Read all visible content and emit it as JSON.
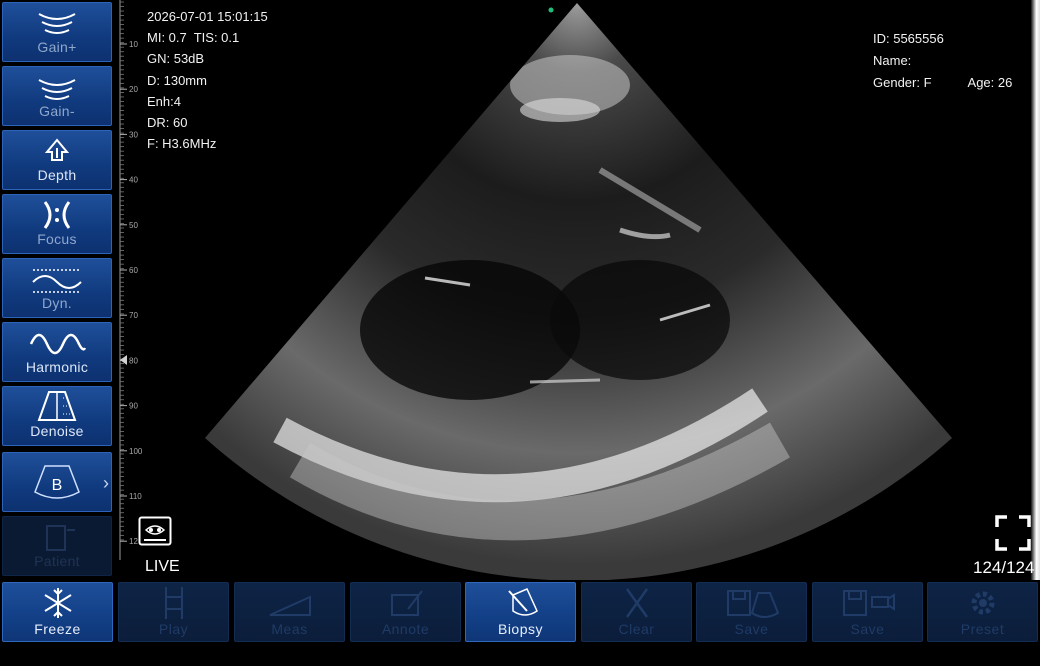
{
  "sidebar": {
    "items": [
      {
        "label": "Gain+",
        "icon": "gain-up-icon",
        "state": "enabled-faded"
      },
      {
        "label": "Gain-",
        "icon": "gain-down-icon",
        "state": "enabled-faded"
      },
      {
        "label": "Depth",
        "icon": "depth-icon",
        "state": "enabled"
      },
      {
        "label": "Focus",
        "icon": "focus-icon",
        "state": "enabled-faded"
      },
      {
        "label": "Dyn.",
        "icon": "dynamic-range-icon",
        "state": "enabled-faded"
      },
      {
        "label": "Harmonic",
        "icon": "harmonic-icon",
        "state": "enabled"
      },
      {
        "label": "Denoise",
        "icon": "denoise-icon",
        "state": "enabled"
      },
      {
        "label": "B",
        "icon": "b-mode-icon",
        "state": "enabled",
        "expand": "›"
      },
      {
        "label": "Patient",
        "icon": "patient-icon",
        "state": "disabled"
      }
    ]
  },
  "ruler": {
    "ticks": [
      "10",
      "20",
      "30",
      "40",
      "50",
      "60",
      "70",
      "80",
      "90",
      "100",
      "110",
      "12"
    ],
    "focus_marker": "80"
  },
  "params": {
    "datetime": "2026-07-01 15:01:15",
    "mi_tis": "MI: 0.7  TIS: 0.1",
    "gain": "GN: 53dB",
    "depth": "D: 130mm",
    "enhance": "Enh:4",
    "dynamic_range": "DR: 60",
    "frequency": "F: H3.6MHz"
  },
  "patient": {
    "id": "ID: 5565556",
    "name": "Name:",
    "gender": "Gender: F",
    "age": "Age: 26"
  },
  "status": {
    "live": "LIVE",
    "frame_count": "124/124"
  },
  "toolbar": {
    "items": [
      {
        "label": "Freeze",
        "icon": "snowflake-icon",
        "active": true
      },
      {
        "label": "Play",
        "icon": "play-film-icon",
        "active": false
      },
      {
        "label": "Meas",
        "icon": "measure-icon",
        "active": false
      },
      {
        "label": "Annote",
        "icon": "annotate-icon",
        "active": false
      },
      {
        "label": "Biopsy",
        "icon": "biopsy-icon",
        "active": true
      },
      {
        "label": "Clear",
        "icon": "clear-x-icon",
        "active": false
      },
      {
        "label": "Save",
        "icon": "save-image-icon",
        "active": false
      },
      {
        "label": "Save",
        "icon": "save-video-icon",
        "active": false
      },
      {
        "label": "Preset",
        "icon": "gear-icon",
        "active": false
      }
    ]
  },
  "colors": {
    "accent": "#1f4f9a",
    "indicator_dot": "#1fbf7a"
  }
}
